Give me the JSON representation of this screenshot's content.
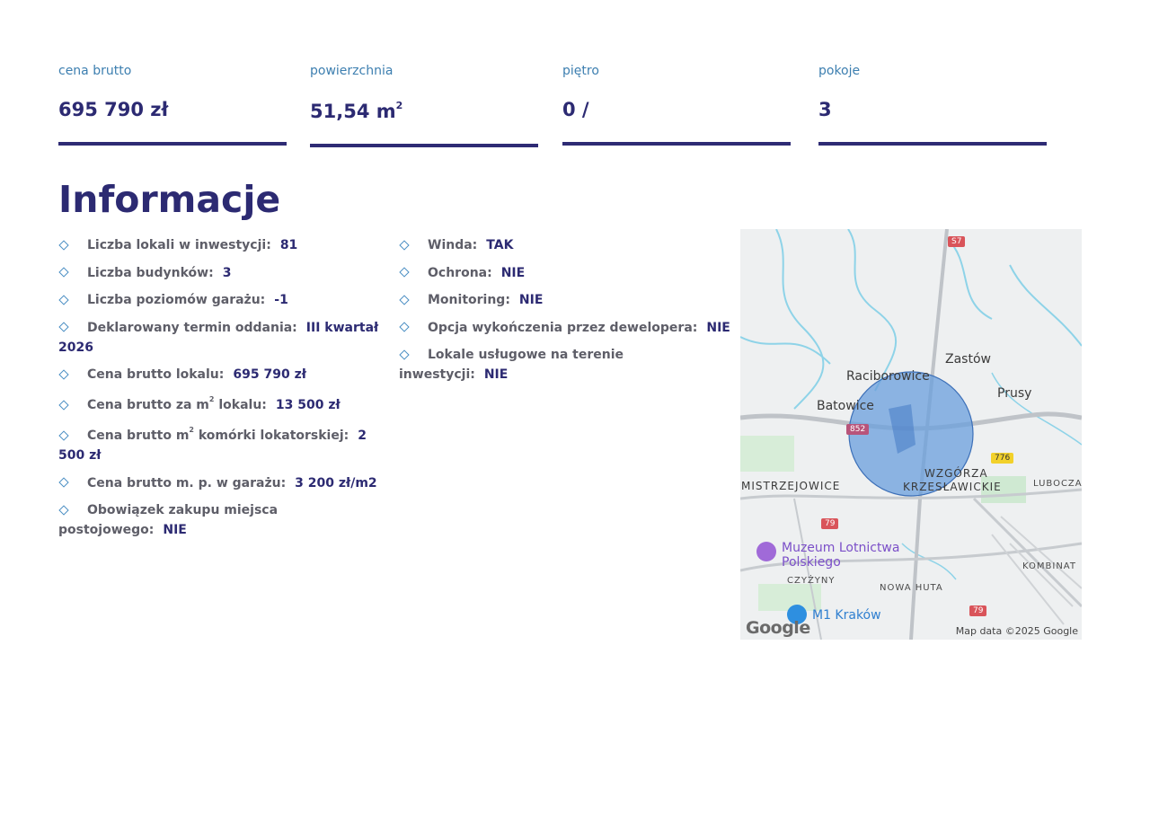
{
  "stats": [
    {
      "label": "cena brutto",
      "value": "695 790 zł"
    },
    {
      "label": "powierzchnia",
      "value": "51,54 m",
      "sup": "2"
    },
    {
      "label": "piętro",
      "value": "0 /"
    },
    {
      "label": "pokoje",
      "value": "3"
    }
  ],
  "section_title": "Informacje",
  "left_items": [
    {
      "label": "Liczba lokali w inwestycji:",
      "value": "81"
    },
    {
      "label": "Liczba budynków:",
      "value": "3"
    },
    {
      "label": "Liczba poziomów garażu:",
      "value": "-1"
    },
    {
      "label": "Deklarowany termin oddania:",
      "value": "III kwartał 2026"
    },
    {
      "label": "Cena brutto lokalu:",
      "value": "695 790 zł"
    },
    {
      "label_pre": "Cena brutto za m",
      "label_sup": "2",
      "label_post": " lokalu:",
      "value": "13 500 zł"
    },
    {
      "label_pre": "Cena brutto m",
      "label_sup": "2",
      "label_post": " komórki lokatorskiej:",
      "value": "2 500 zł"
    },
    {
      "label": "Cena brutto m. p. w garażu:",
      "value": "3 200 zł/m2"
    },
    {
      "label": "Obowiązek zakupu miejsca postojowego:",
      "value": "NIE"
    }
  ],
  "right_items": [
    {
      "label": "Winda:",
      "value": "TAK"
    },
    {
      "label": "Ochrona:",
      "value": "NIE"
    },
    {
      "label": "Monitoring:",
      "value": "NIE"
    },
    {
      "label": "Opcja wykończenia przez dewelopera:",
      "value": "NIE"
    },
    {
      "label": "Lokale usługowe na terenie inwestycji:",
      "value": "NIE"
    }
  ],
  "map": {
    "places": {
      "zastow": "Zastów",
      "raciborowice": "Raciborowice",
      "prusy": "Prusy",
      "batowice": "Batowice",
      "wzgorza1": "WZGÓRZA",
      "wzgorza2": "KRZESŁAWICKIE",
      "mistrzejowice": "MISTRZEJOWICE",
      "lubocza": "LUBOCZA",
      "kombinat": "KOMBINAT",
      "czyzyny": "CZYŻYNY",
      "nowa_huta": "NOWA HUTA",
      "muzeum1": "Muzeum Lotnictwa",
      "muzeum2": "Polskiego",
      "m1": "M1 Kraków"
    },
    "roads": {
      "s7": "S7",
      "r852": "852",
      "r776": "776",
      "r79a": "79",
      "r79b": "79"
    },
    "credit": "Map data ©2025 Google",
    "logo": "Google",
    "accent_circle": "#6a9fdc",
    "water_color": "#8ed3e8"
  }
}
